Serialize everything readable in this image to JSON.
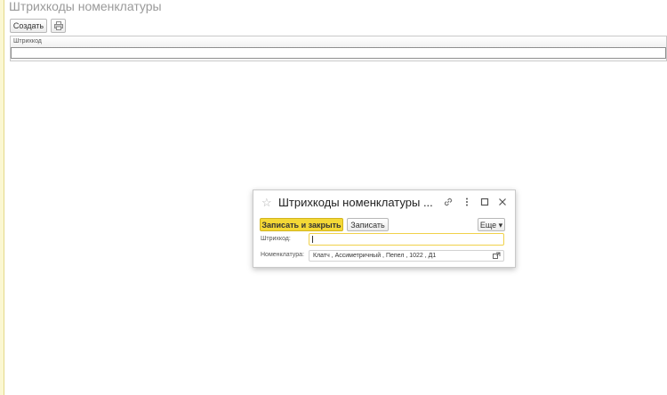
{
  "page": {
    "title": "Штрихкоды номенклатуры",
    "toolbar": {
      "create_label": "Создать",
      "print_icon": "print-icon"
    },
    "table": {
      "columns": [
        "Штрихкод"
      ],
      "rows": []
    }
  },
  "dialog": {
    "title": "Штрихкоды номенклатуры ...",
    "icons": [
      "star-icon",
      "link-icon",
      "more-vertical-icon",
      "maximize-icon",
      "close-icon"
    ],
    "toolbar": {
      "save_close_label": "Записать и закрыть",
      "save_label": "Записать",
      "more_label": "Еще ▾"
    },
    "fields": {
      "barcode_label": "Штрихкод:",
      "barcode_value": "",
      "nomenclature_label": "Номенклатура:",
      "nomenclature_value": "Клатч , Ассиметричный , Пепел , 1022 , Д1"
    }
  },
  "colors": {
    "accent": "#f4d836",
    "stripe": "#fbf7d2"
  }
}
